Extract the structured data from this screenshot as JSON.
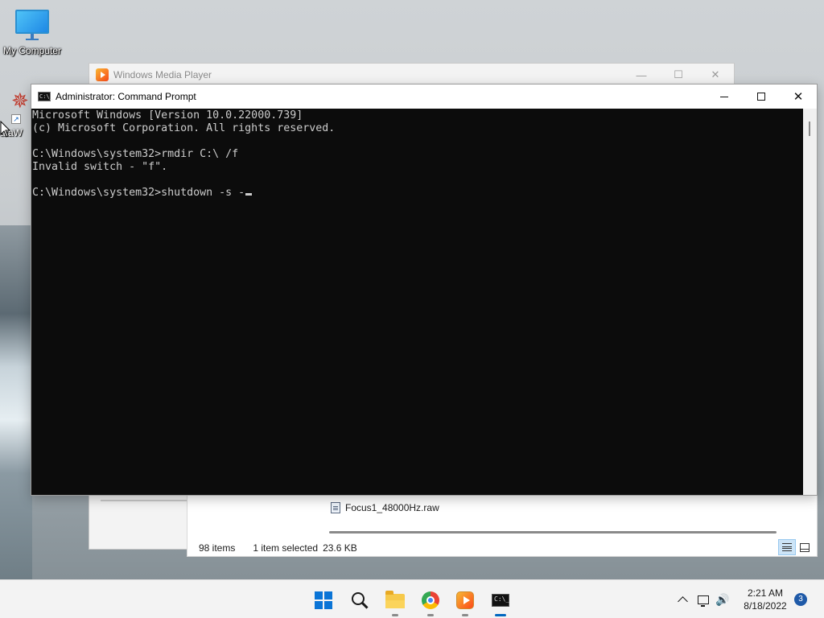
{
  "desktop": {
    "icons": [
      {
        "label": "My Computer"
      },
      {
        "label": "ataW"
      }
    ]
  },
  "background_windows": {
    "media_player": {
      "title": "Windows Media Player",
      "controls": {
        "minimize": "—",
        "maximize": "☐",
        "close": "✕"
      }
    },
    "explorer": {
      "file_name": "Focus1_48000Hz.raw",
      "status": {
        "item_count": "98 items",
        "selection": "1 item selected",
        "size": "23.6 KB"
      }
    }
  },
  "cmd": {
    "title": "Administrator: Command Prompt",
    "logo_text": "C:\\_",
    "lines": [
      "Microsoft Windows [Version 10.0.22000.739]",
      "(c) Microsoft Corporation. All rights reserved.",
      "",
      "C:\\Windows\\system32>rmdir C:\\ /f",
      "Invalid switch - \"f\".",
      "",
      "C:\\Windows\\system32>shutdown -s -"
    ],
    "controls": {
      "close": "✕"
    }
  },
  "taskbar": {
    "apps": [
      {
        "name": "start",
        "icon": "windows-logo-icon"
      },
      {
        "name": "search",
        "icon": "search-icon"
      },
      {
        "name": "file-explorer",
        "icon": "folder-icon"
      },
      {
        "name": "chrome",
        "icon": "chrome-icon"
      },
      {
        "name": "media-player",
        "icon": "media-player-icon"
      },
      {
        "name": "command-prompt",
        "icon": "terminal-icon"
      }
    ],
    "cmd_icon_text": "C:\\_",
    "tray": {
      "chevron": "show-hidden-icons",
      "volume_glyph": "🔊"
    },
    "clock": {
      "time": "2:21 AM",
      "date": "8/18/2022"
    },
    "notifications": "3"
  },
  "colors": {
    "console_bg": "#0c0c0c",
    "console_text": "#cccccc",
    "accent": "#0067c0"
  }
}
